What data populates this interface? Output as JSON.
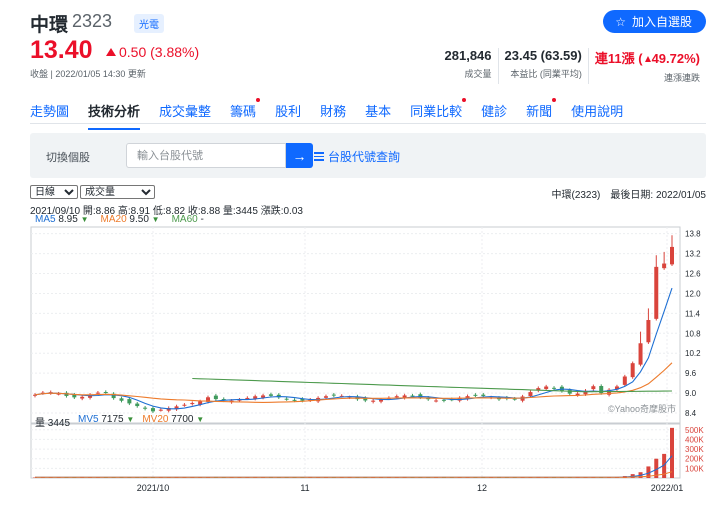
{
  "stock": {
    "name": "中環",
    "code": "2323",
    "tag": "光電",
    "add_button": "加入自選股",
    "price": "13.40",
    "change": "0.50 (3.88%)",
    "close_info": "收盤 | 2022/01/05 14:30 更新"
  },
  "stats": [
    {
      "value": "281,846",
      "label": "成交量",
      "red": false
    },
    {
      "value": "23.45 (63.59)",
      "label": "本益比 (同業平均)",
      "red": false
    },
    {
      "value": "連11漲",
      "value2": "49.72%)",
      "value_paren": "(",
      "label": "連漲連跌",
      "red": true
    }
  ],
  "tabs": [
    {
      "label": "走勢圖",
      "active": false,
      "dot": false
    },
    {
      "label": "技術分析",
      "active": true,
      "dot": false
    },
    {
      "label": "成交彙整",
      "active": false,
      "dot": false
    },
    {
      "label": "籌碼",
      "active": false,
      "dot": true
    },
    {
      "label": "股利",
      "active": false,
      "dot": false
    },
    {
      "label": "財務",
      "active": false,
      "dot": false
    },
    {
      "label": "基本",
      "active": false,
      "dot": false
    },
    {
      "label": "同業比較",
      "active": false,
      "dot": true
    },
    {
      "label": "健診",
      "active": false,
      "dot": false
    },
    {
      "label": "新聞",
      "active": false,
      "dot": true
    },
    {
      "label": "使用說明",
      "active": false,
      "dot": false
    }
  ],
  "search": {
    "label": "切換個股",
    "placeholder": "輸入台股代號",
    "lookup": "台股代號查詢"
  },
  "controls": {
    "period_selected": "日線",
    "indicator_selected": "成交量",
    "right_info": "中環(2323)　最後日期: 2022/01/05",
    "ohlc": "2021/09/10  開:8.86  高:8.91  低:8.82  收:8.88  量:3445  漲跌:0.03"
  },
  "ma_legend": [
    {
      "label": "MA5",
      "value": "8.95",
      "color": "#1e6fd3"
    },
    {
      "label": "MA20",
      "value": "9.50",
      "color": "#ed7b2c"
    },
    {
      "label": "MA60",
      "value": "-",
      "color": "#4d9a4d"
    }
  ],
  "vol_legend": [
    {
      "label": "量",
      "value": "3445",
      "color": "#232a31"
    },
    {
      "label": "MV5",
      "value": "7175",
      "color": "#1e6fd3"
    },
    {
      "label": "MV20",
      "value": "7700",
      "color": "#ed7b2c"
    }
  ],
  "chart_data": {
    "type": "candlestick",
    "y_ticks": [
      "13.8",
      "13.2",
      "12.6",
      "12.0",
      "11.4",
      "10.8",
      "10.2",
      "9.6",
      "9.0",
      "8.4"
    ],
    "ylim": [
      8.1,
      14.0
    ],
    "vol_ticks": [
      "500K",
      "400K",
      "300K",
      "200K",
      "100K"
    ],
    "vol_ylim": [
      0,
      560000
    ],
    "x_labels": [
      "2021/10",
      "11",
      "12",
      "2022/01"
    ],
    "watermark": "©Yahoo奇摩股市",
    "colors": {
      "up": "#d9443c",
      "down": "#3f9a5d",
      "ma5": "#1e6fd3",
      "ma20": "#ed7b2c",
      "ma60": "#4d9a4d"
    }
  }
}
